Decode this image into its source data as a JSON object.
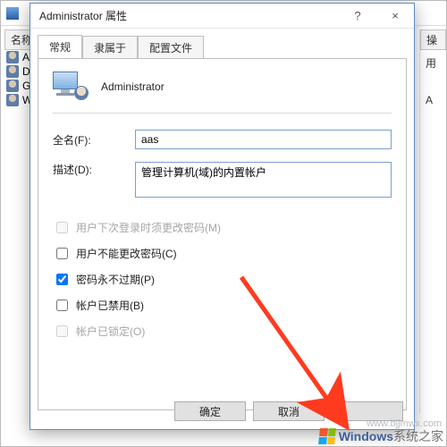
{
  "background": {
    "name_col": "名称",
    "actions_col": "操",
    "actions_sub": "用",
    "action_item": "A",
    "users": [
      "Admini",
      "Defau",
      "Gues",
      "WDA"
    ]
  },
  "dialog": {
    "title": "Administrator 属性",
    "help_glyph": "?",
    "close_glyph": "×",
    "tabs": {
      "general": "常规",
      "memberof": "隶属于",
      "profile": "配置文件"
    },
    "account_name": "Administrator",
    "fields": {
      "fullname_label": "全名(F):",
      "fullname_value": "aas",
      "desc_label": "描述(D):",
      "desc_value": "管理计算机(域)的内置帐户"
    },
    "checks": {
      "must_change": "用户下次登录时须更改密码(M)",
      "cannot_change": "用户不能更改密码(C)",
      "never_expire": "密码永不过期(P)",
      "disabled": "帐户已禁用(B)",
      "locked": "帐户已锁定(O)"
    },
    "buttons": {
      "ok": "确定",
      "cancel": "取消",
      "apply": ""
    }
  },
  "watermark": {
    "brand": "Windows",
    "suffix": "系统之家",
    "url": "www.bjjmwx.com"
  }
}
